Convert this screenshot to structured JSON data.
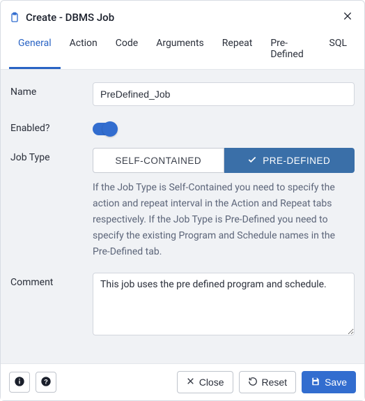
{
  "header": {
    "title": "Create - DBMS Job"
  },
  "tabs": [
    {
      "label": "General",
      "active": true
    },
    {
      "label": "Action",
      "active": false
    },
    {
      "label": "Code",
      "active": false
    },
    {
      "label": "Arguments",
      "active": false
    },
    {
      "label": "Repeat",
      "active": false
    },
    {
      "label": "Pre-Defined",
      "active": false
    },
    {
      "label": "SQL",
      "active": false
    }
  ],
  "form": {
    "name_label": "Name",
    "name_value": "PreDefined_Job",
    "enabled_label": "Enabled?",
    "enabled_value": true,
    "job_type_label": "Job Type",
    "job_type_options": {
      "self_contained": "SELF-CONTAINED",
      "pre_defined": "PRE-DEFINED"
    },
    "job_type_help": "If the Job Type is Self-Contained you need to specify the action and repeat interval in the Action and Repeat tabs respectively. If the Job Type is Pre-Defined you need to specify the existing Program and Schedule names in the Pre-Defined tab.",
    "comment_label": "Comment",
    "comment_value": "This job uses the pre defined program and schedule."
  },
  "footer": {
    "close_label": "Close",
    "reset_label": "Reset",
    "save_label": "Save"
  }
}
